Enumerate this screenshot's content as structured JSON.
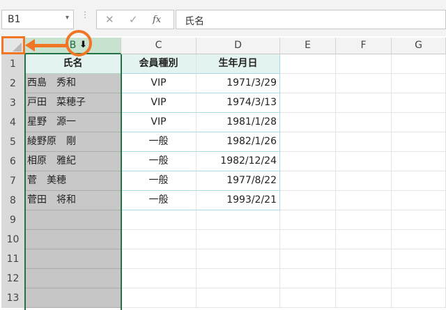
{
  "formula_bar": {
    "name_box": "B1",
    "name_box_arrow": "▾",
    "dots": "⋮",
    "cancel_icon": "✕",
    "enter_icon": "✓",
    "fx_label": "fx",
    "formula": "氏名"
  },
  "columns": [
    "B",
    "C",
    "D",
    "E",
    "F",
    "G"
  ],
  "rows": [
    "1",
    "2",
    "3",
    "4",
    "5",
    "6",
    "7",
    "8",
    "9",
    "10",
    "11",
    "12",
    "13"
  ],
  "headers": {
    "name": "氏名",
    "member_type": "会員種別",
    "birthday": "生年月日"
  },
  "records": [
    {
      "name": "西島　秀和",
      "member_type": "VIP",
      "birthday": "1971/3/29"
    },
    {
      "name": "戸田　菜穂子",
      "member_type": "VIP",
      "birthday": "1974/3/13"
    },
    {
      "name": "星野　源一",
      "member_type": "VIP",
      "birthday": "1981/1/28"
    },
    {
      "name": "綾野原　剛",
      "member_type": "一般",
      "birthday": "1982/1/26"
    },
    {
      "name": "相原　雅紀",
      "member_type": "一般",
      "birthday": "1982/12/24"
    },
    {
      "name": "菅　美穂",
      "member_type": "一般",
      "birthday": "1977/8/22"
    },
    {
      "name": "菅田　将和",
      "member_type": "一般",
      "birthday": "1993/2/21"
    }
  ],
  "annotation": {
    "down_arrow_glyph": "⬇"
  },
  "colors": {
    "accent": "#f07524",
    "selection": "#217346",
    "header_fill": "#e3f4f0"
  }
}
